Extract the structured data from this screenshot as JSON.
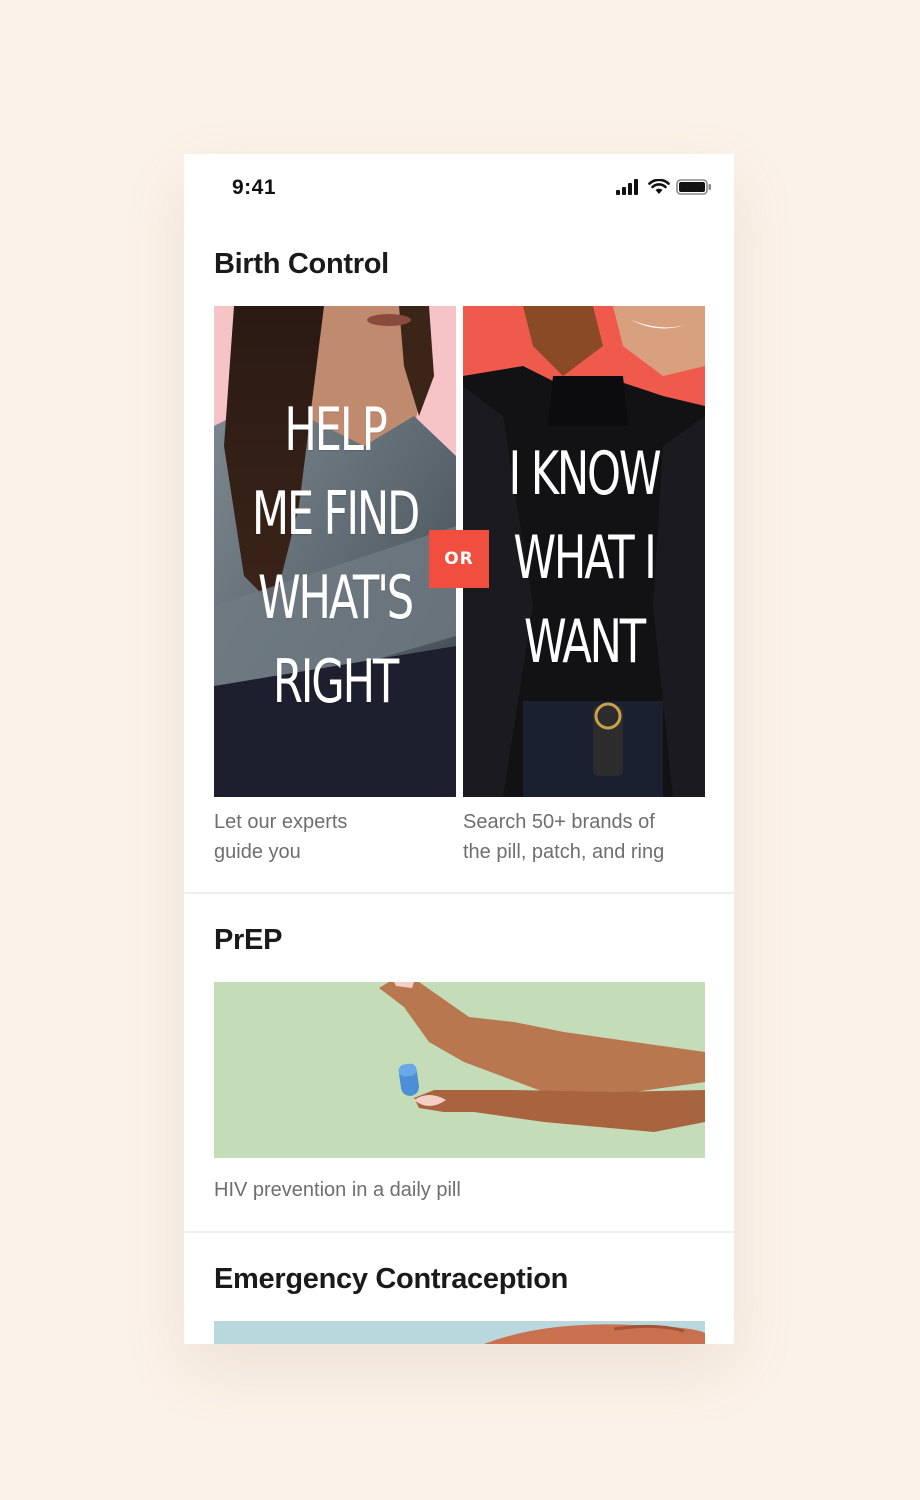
{
  "status_bar": {
    "time": "9:41"
  },
  "icons": {
    "signal": "signal-bars-icon",
    "wifi": "wifi-icon",
    "battery": "battery-icon"
  },
  "colors": {
    "page_background": "#fbf2e9",
    "accent_red": "#f04e3e",
    "pink_background": "#f6c3c7",
    "prep_green": "#c4dcb8",
    "ec_blue": "#b9d8de"
  },
  "birth_control": {
    "title": "Birth Control",
    "left_card": {
      "image_text_lines": [
        "HELP",
        "ME FIND",
        "WHAT'S",
        "RIGHT"
      ],
      "caption_line1": "Let our experts",
      "caption_line2": "guide you"
    },
    "or_label": "OR",
    "right_card": {
      "image_text_lines": [
        "I KNOW",
        "WHAT I",
        "WANT"
      ],
      "caption_line1": "Search 50+ brands of",
      "caption_line2": "the pill, patch, and ring"
    }
  },
  "prep": {
    "title": "PrEP",
    "caption": "HIV prevention in a daily pill"
  },
  "emergency": {
    "title": "Emergency Contraception"
  }
}
